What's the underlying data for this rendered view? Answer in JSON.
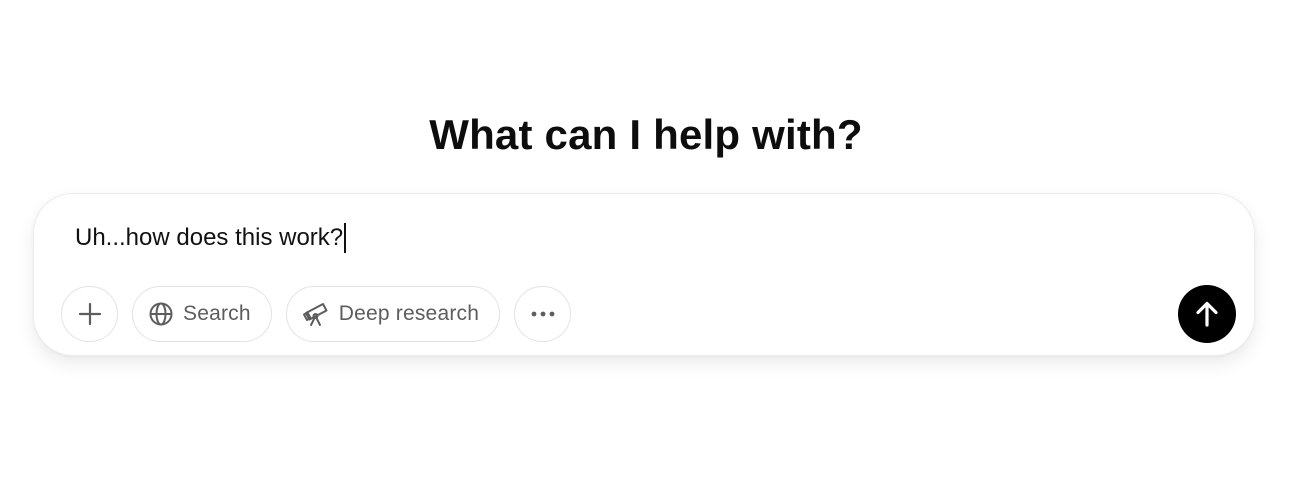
{
  "heading": "What can I help with?",
  "composer": {
    "input_value": "Uh...how does this work?",
    "tools": {
      "attach": {
        "icon": "plus-icon"
      },
      "search": {
        "label": "Search",
        "icon": "globe-icon"
      },
      "deep_research": {
        "label": "Deep research",
        "icon": "telescope-icon"
      },
      "more": {
        "icon": "ellipsis-icon"
      }
    },
    "send": {
      "icon": "arrow-up-icon",
      "color": "#000000"
    }
  }
}
